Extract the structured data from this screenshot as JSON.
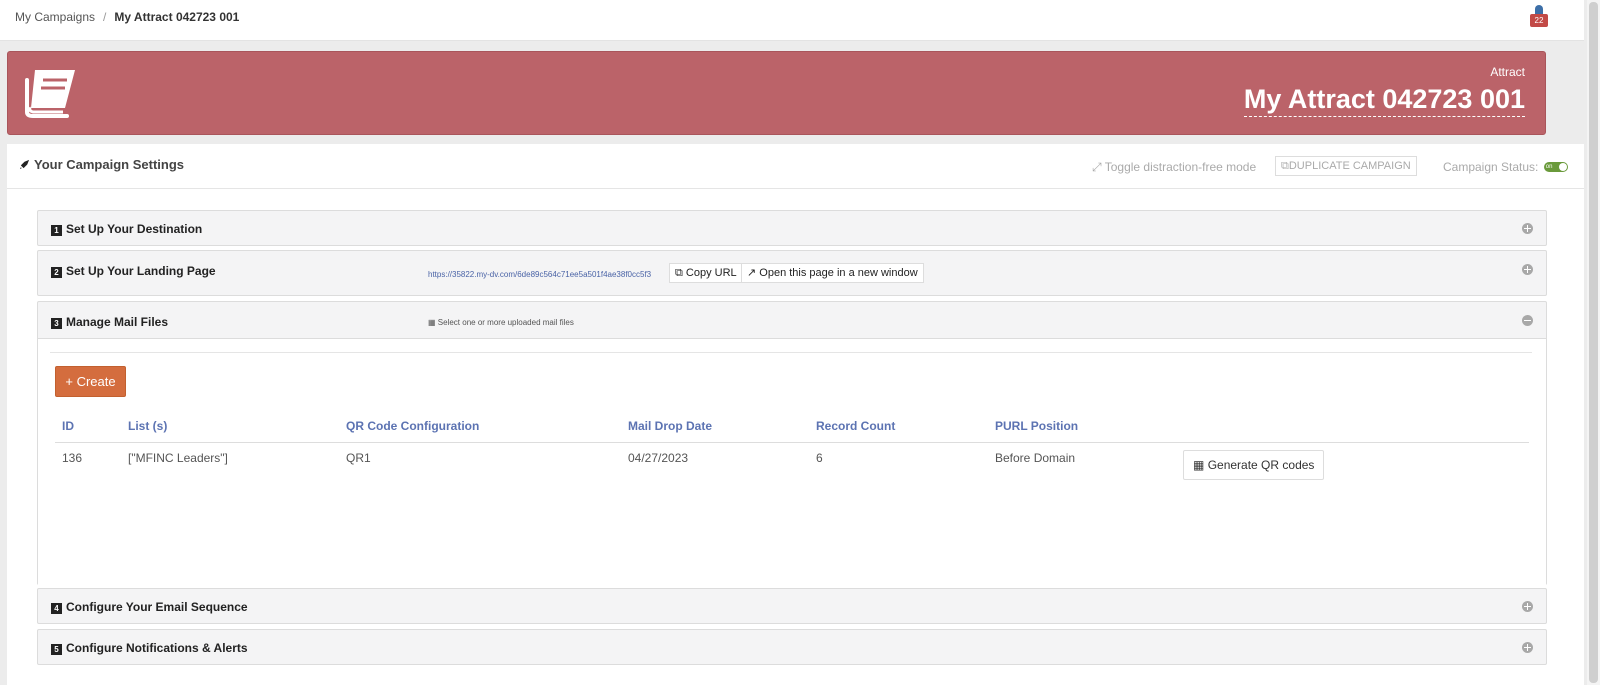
{
  "breadcrumb": {
    "parent": "My Campaigns",
    "separator": "/",
    "current": "My Attract 042723 001"
  },
  "notifications": {
    "count": "22"
  },
  "banner": {
    "subtitle": "Attract",
    "title": "My Attract 042723 001",
    "color": "#bb6369"
  },
  "settings": {
    "title": "Your Campaign Settings",
    "toggle_label": "Toggle distraction-free mode",
    "duplicate_label": "DUPLICATE CAMPAIGN",
    "status_label": "Campaign Status:",
    "status_switch": "on"
  },
  "panels": [
    {
      "num": "1",
      "title": "Set Up Your Destination"
    },
    {
      "num": "2",
      "title": "Set Up Your Landing Page",
      "url": "https://35822.my-dv.com/6de89c564c71ee5a501f4ae38f0cc5f3",
      "copy_label": "Copy URL",
      "open_label": "Open this page in a new window"
    },
    {
      "num": "3",
      "title": "Manage Mail Files",
      "hint": "Select one or more uploaded mail files",
      "create_label": "+ Create",
      "columns": [
        "ID",
        "List (s)",
        "QR Code Configuration",
        "Mail Drop Date",
        "Record Count",
        "PURL Position"
      ],
      "rows": [
        {
          "id": "136",
          "list": "[\"MFINC Leaders\"]",
          "qr": "QR1",
          "date": "04/27/2023",
          "count": "6",
          "purl": "Before Domain",
          "action": "Generate QR codes"
        }
      ]
    },
    {
      "num": "4",
      "title": "Configure Your Email Sequence"
    },
    {
      "num": "5",
      "title": "Configure Notifications & Alerts"
    }
  ]
}
